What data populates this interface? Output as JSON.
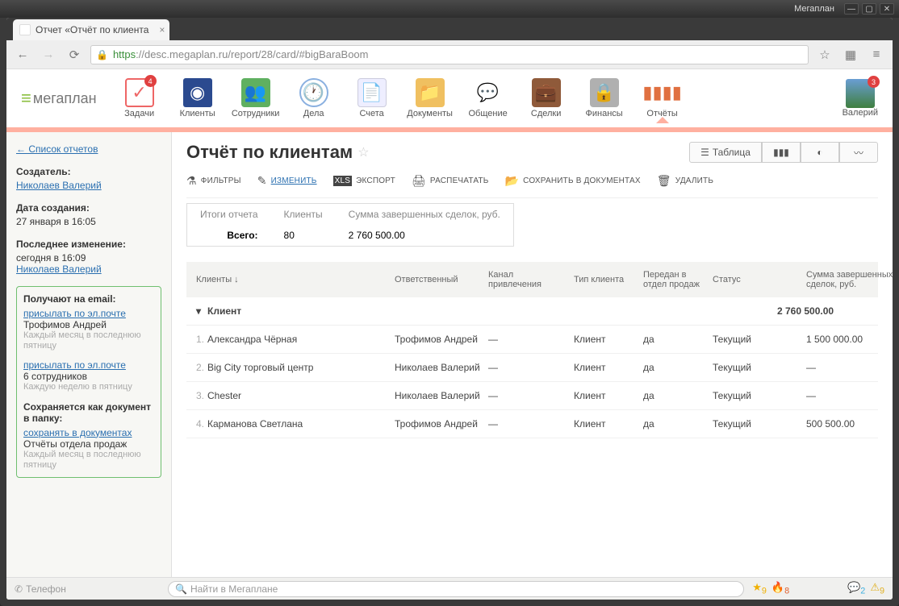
{
  "window": {
    "app": "Мегаплан"
  },
  "tab": {
    "title": "Отчет «Отчёт по клиента"
  },
  "url": {
    "scheme": "https",
    "host": "://desc.megaplan.ru",
    "path": "/report/28/card/#bigBaraBoom"
  },
  "logo": "мегаплан",
  "nav": [
    {
      "label": "Задачи",
      "icon": "checkbox",
      "badge": "4"
    },
    {
      "label": "Клиенты",
      "icon": "book"
    },
    {
      "label": "Сотрудники",
      "icon": "people"
    },
    {
      "label": "Дела",
      "icon": "clock"
    },
    {
      "label": "Счета",
      "icon": "doc"
    },
    {
      "label": "Документы",
      "icon": "folder"
    },
    {
      "label": "Общение",
      "icon": "chat"
    },
    {
      "label": "Сделки",
      "icon": "briefcase"
    },
    {
      "label": "Финансы",
      "icon": "safe"
    },
    {
      "label": "Отчёты",
      "icon": "bars",
      "active": true
    }
  ],
  "user": {
    "name": "Валерий",
    "badge": "3"
  },
  "sidebar": {
    "back": "← Список отчетов",
    "creator_label": "Создатель:",
    "creator": "Николаев Валерий",
    "created_label": "Дата создания:",
    "created": "27 января в 16:05",
    "modified_label": "Последнее изменение:",
    "modified_date": "сегодня в 16:09",
    "modified_by": "Николаев Валерий",
    "email_header": "Получают на email:",
    "email_link1": "присылать по эл.почте",
    "email_who1": "Трофимов Андрей",
    "email_note1": "Каждый месяц в последнюю пятницу",
    "email_link2": "присылать по эл.почте",
    "email_who2": "6 сотрудников",
    "email_note2": "Каждую неделю в пятницу",
    "doc_header": "Сохраняется как документ в папку:",
    "doc_link": "сохранять в документах",
    "doc_folder": "Отчёты отдела продаж",
    "doc_note": "Каждый месяц в последнюю пятницу"
  },
  "report": {
    "title": "Отчёт по клиентам",
    "view_table": "Таблица",
    "toolbar": {
      "filters": "ФИЛЬТРЫ",
      "edit": "ИЗМЕНИТЬ",
      "export": "ЭКСПОРТ",
      "print": "РАСПЕЧАТАТЬ",
      "save_doc": "СОХРАНИТЬ В ДОКУМЕНТАХ",
      "delete": "УДАЛИТЬ"
    },
    "summary": {
      "header": "Итоги отчета",
      "col1": "Клиенты",
      "col2": "Сумма завершенных сделок, руб.",
      "row_label": "Всего:",
      "clients": "80",
      "amount": "2 760 500.00"
    },
    "columns": {
      "client": "Клиенты ↓",
      "resp": "Ответственный",
      "channel": "Канал привлечения",
      "type": "Тип клиента",
      "transferred": "Передан в отдел продаж",
      "status": "Статус",
      "sum": "Сумма завершенных сделок, руб."
    },
    "group": {
      "label": "Клиент",
      "sum": "2 760 500.00"
    },
    "rows": [
      {
        "idx": "1.",
        "name": "Александра Чёрная",
        "resp": "Трофимов Андрей",
        "channel": "—",
        "type": "Клиент",
        "transferred": "да",
        "status": "Текущий",
        "sum": "1 500 000.00"
      },
      {
        "idx": "2.",
        "name": "Big City торговый центр",
        "resp": "Николаев Валерий",
        "channel": "—",
        "type": "Клиент",
        "transferred": "да",
        "status": "Текущий",
        "sum": "—"
      },
      {
        "idx": "3.",
        "name": "Chester",
        "resp": "Николаев Валерий",
        "channel": "—",
        "type": "Клиент",
        "transferred": "да",
        "status": "Текущий",
        "sum": "—"
      },
      {
        "idx": "4.",
        "name": "Карманова Светлана",
        "resp": "Трофимов Андрей",
        "channel": "—",
        "type": "Клиент",
        "transferred": "да",
        "status": "Текущий",
        "sum": "500 500.00"
      }
    ]
  },
  "footer": {
    "phone": "Телефон",
    "search_placeholder": "Найти в Мегаплане",
    "star_count": "9",
    "fire_count": "8",
    "chat_count": "2",
    "warn_count": "9"
  }
}
